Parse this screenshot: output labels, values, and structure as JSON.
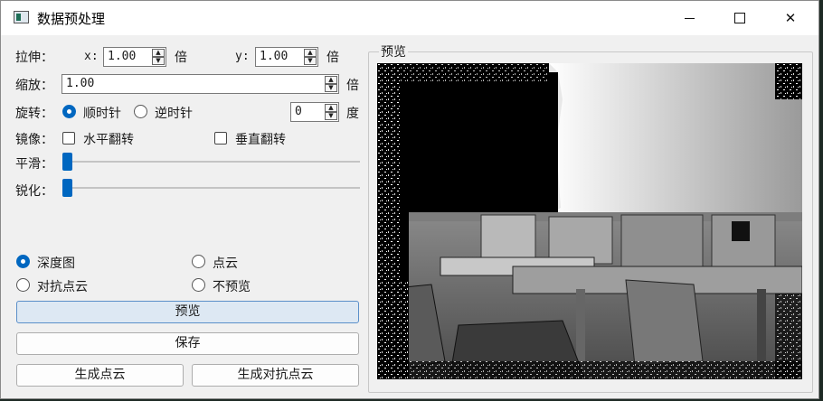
{
  "window": {
    "title": "数据预处理"
  },
  "stretch": {
    "label": "拉伸：",
    "x_label": "x:",
    "x_value": "1.00",
    "y_label": "y:",
    "y_value": "1.00",
    "unit": "倍"
  },
  "scale": {
    "label": "缩放：",
    "value": "1.00",
    "unit": "倍"
  },
  "rotate": {
    "label": "旋转：",
    "clockwise": "顺时针",
    "counterclockwise": "逆时针",
    "selected": "顺时针",
    "angle": "0",
    "unit": "度"
  },
  "mirror": {
    "label": "镜像：",
    "horizontal": "水平翻转",
    "vertical": "垂直翻转"
  },
  "smooth": {
    "label": "平滑：",
    "value": 0
  },
  "sharpen": {
    "label": "锐化：",
    "value": 0
  },
  "mode": {
    "depth_map": "深度图",
    "point_cloud": "点云",
    "adversarial_point_cloud": "对抗点云",
    "no_preview": "不预览",
    "selected": "深度图"
  },
  "buttons": {
    "preview": "预览",
    "save": "保存",
    "generate_point_cloud": "生成点云",
    "generate_adversarial": "生成对抗点云"
  },
  "preview_group": {
    "title": "预览"
  }
}
